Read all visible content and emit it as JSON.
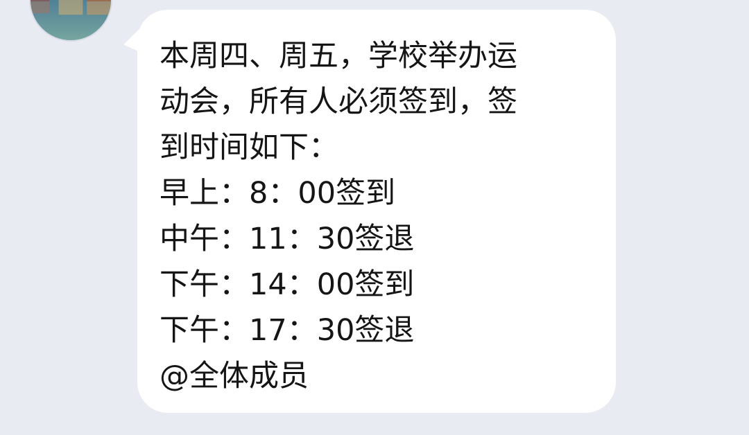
{
  "message": {
    "lines": [
      "本周四、周五，学校举办运",
      "动会，所有人必须签到，签",
      "到时间如下：",
      "早上：8：00签到",
      "中午：11：30签退",
      "下午：14：00签到",
      "下午：17：30签退",
      "@全体成员"
    ]
  },
  "colors": {
    "background": "#e9ebf2",
    "bubble": "#ffffff",
    "text": "#151515"
  },
  "icons": {
    "avatar": "sender-avatar"
  }
}
